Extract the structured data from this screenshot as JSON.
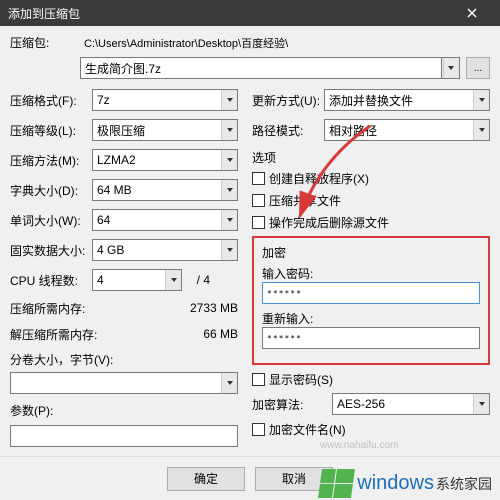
{
  "window": {
    "title": "添加到压缩包"
  },
  "path": {
    "label": "压缩包:",
    "value": "C:\\Users\\Administrator\\Desktop\\百度经验\\"
  },
  "archive": {
    "value": "生成简介图.7z"
  },
  "left": {
    "format": {
      "label": "压缩格式",
      "hot": "(F)",
      "value": "7z"
    },
    "level": {
      "label": "压缩等级",
      "hot": "(L)",
      "value": "极限压缩"
    },
    "method": {
      "label": "压缩方法",
      "hot": "(M)",
      "value": "LZMA2"
    },
    "dict": {
      "label": "字典大小",
      "hot": "(D)",
      "value": "64 MB"
    },
    "word": {
      "label": "单词大小",
      "hot": "(W)",
      "value": "64"
    },
    "solid": {
      "label": "固实数据大小:",
      "value": "4 GB"
    },
    "cpu": {
      "label": "CPU 线程数:",
      "value": "4",
      "suffix": "/ 4"
    },
    "mem_comp": {
      "label": "压缩所需内存:",
      "value": "2733 MB"
    },
    "mem_decomp": {
      "label": "解压缩所需内存:",
      "value": "66 MB"
    },
    "split": {
      "label": "分卷大小，字节",
      "hot": "(V)",
      "value": ""
    },
    "params": {
      "label": "参数",
      "hot": "(P)",
      "value": ""
    }
  },
  "right": {
    "update": {
      "label": "更新方式",
      "hot": "(U)",
      "value": "添加并替换文件"
    },
    "pathmode": {
      "label": "路径模式:",
      "value": "相对路径"
    },
    "options_title": "选项",
    "opts": {
      "sfx": "创建自释放程序(X)",
      "share": "压缩共享文件",
      "delete": "操作完成后删除源文件"
    },
    "enc": {
      "title": "加密",
      "pw_label": "输入密码:",
      "pw_value": "******",
      "pw2_label": "重新输入:",
      "pw2_value": "******",
      "show": "显示密码(S)",
      "algo_label": "加密算法:",
      "algo_value": "AES-256",
      "enc_names": "加密文件名(N)"
    }
  },
  "footer": {
    "ok": "确定",
    "cancel": "取消"
  },
  "watermark": {
    "url": "www.nahaifu.com",
    "brand1": "windows",
    "brand2": "系统家园"
  }
}
